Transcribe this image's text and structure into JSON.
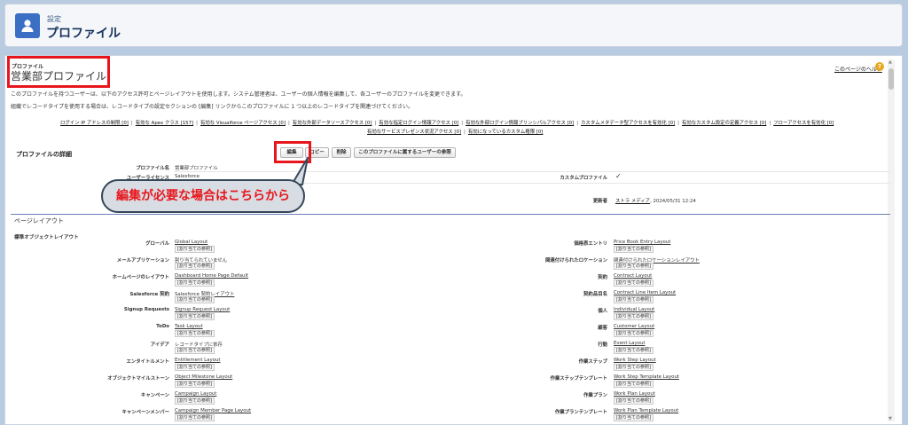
{
  "header": {
    "subtitle": "設定",
    "title": "プロファイル"
  },
  "profile": {
    "type_label": "プロファイル",
    "name": "営業部プロファイル"
  },
  "help": {
    "link": "このページのヘルプ",
    "icon": "?"
  },
  "description": {
    "line1": "このプロファイルを持つユーザーは、以下のアクセス許可とページレイアウトを使用します。システム管理者は、ユーザーの個人情報を編集して、各ユーザーのプロファイルを変更できます。",
    "line2": "組織でレコードタイプを使用する場合は、レコードタイプの設定セクションの [編集] リンクからこのプロファイルに 1 つ以上のレコードタイプを関連づけてください。"
  },
  "quick_links_row1": [
    "ログイン IP アドレスの制限 [0]",
    "有効な Apex クラス [157]",
    "有効な Visualforce ページアクセス [0]",
    "有効な外部データソースアクセス [0]",
    "有効な指定ログイン情報アクセス [0]",
    "有効な外部ログイン情報プリンシパルアクセス [0]",
    "カスタムメタデータ型アクセスを有効化 [0]",
    "有効なカスタム設定の定義アクセス [0]",
    "フローアクセスを有効化 [0]"
  ],
  "quick_links_row2": [
    "有効なサービスプレゼンス状況アクセス [0]",
    "有効になっているカスタム権限 [0]"
  ],
  "details": {
    "section_title": "プロファイルの詳細",
    "buttons": {
      "edit": "編集",
      "copy": "コピー",
      "delete": "削除",
      "view_users": "このプロファイルに属するユーザーの参照"
    },
    "profile_name_label": "プロファイル名",
    "profile_name_value": "営業部プロファイル",
    "license_label": "ユーザーライセンス",
    "license_value": "Salesforce",
    "custom_label": "カスタムプロファイル",
    "custom_value": "✓",
    "modified_label": "更新者",
    "modified_user": "ストラ メディア",
    "modified_date": ", 2024/05/31 12:24"
  },
  "callout": "編集が必要な場合はこちらから",
  "layouts": {
    "section_title": "ページレイアウト",
    "sub_title": "標準オブジェクトレイアウト",
    "assign_label": "[割り当ての参照]",
    "left": [
      {
        "label": "グローバル",
        "value": "Global Layout",
        "link": true
      },
      {
        "label": "メールアプリケーション",
        "value": "割り当てられていません",
        "link": false
      },
      {
        "label": "ホームページのレイアウト",
        "value": "Dashboard Home Page Default",
        "link": true
      },
      {
        "label": "Salesforce 契約",
        "value": "Salesforce 契約レイアウト",
        "link": true
      },
      {
        "label": "Signup Requests",
        "value": "Signup Request Layout",
        "link": true
      },
      {
        "label": "ToDo",
        "value": "Task Layout",
        "link": true
      },
      {
        "label": "アイデア",
        "value": "レコードタイプに依存",
        "link": false
      },
      {
        "label": "エンタイトルメント",
        "value": "Entitlement Layout",
        "link": true
      },
      {
        "label": "オブジェクトマイルストーン",
        "value": "Object Milestone Layout",
        "link": true
      },
      {
        "label": "キャンペーン",
        "value": "Campaign Layout",
        "link": true
      },
      {
        "label": "キャンペーンメンバー",
        "value": "Campaign Member Page Layout",
        "link": true
      }
    ],
    "right": [
      {
        "label": "価格表エントリ",
        "value": "Price Book Entry Layout",
        "link": true
      },
      {
        "label": "関連付けられたロケーション",
        "value": "関連付けられたロケーションレイアウト",
        "link": true
      },
      {
        "label": "契約",
        "value": "Contract Layout",
        "link": true
      },
      {
        "label": "契約品目名",
        "value": "Contract Line Item Layout",
        "link": true
      },
      {
        "label": "個人",
        "value": "Individual Layout",
        "link": true
      },
      {
        "label": "顧客",
        "value": "Customer Layout",
        "link": true
      },
      {
        "label": "行動",
        "value": "Event Layout",
        "link": true
      },
      {
        "label": "作業ステップ",
        "value": "Work Step Layout",
        "link": true
      },
      {
        "label": "作業ステップテンプレート",
        "value": "Work Step Template Layout",
        "link": true
      },
      {
        "label": "作業プラン",
        "value": "Work Plan Layout",
        "link": true
      },
      {
        "label": "作業プランテンプレート",
        "value": "Work Plan Template Layout",
        "link": true
      }
    ]
  },
  "colors": {
    "highlight": "#e8161c",
    "accent": "#3a6fc4",
    "link": "#015ba7"
  },
  "icons": {
    "header": "user-profile-icon",
    "help": "help-icon"
  }
}
